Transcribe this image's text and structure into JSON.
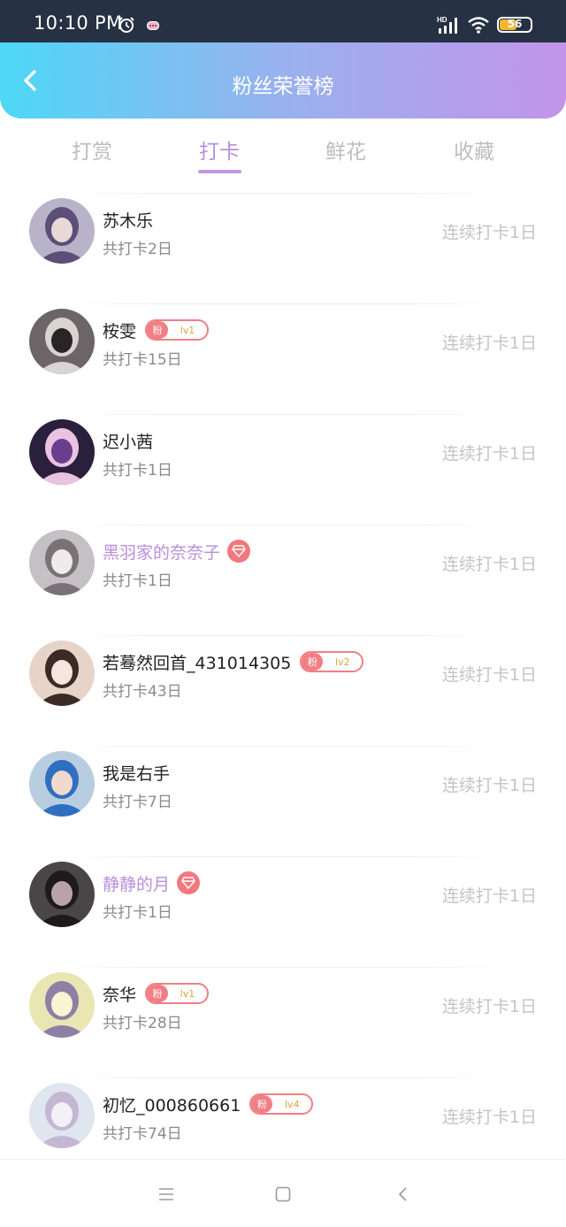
{
  "status_bar": {
    "time": "10:10 PM",
    "battery": "56",
    "battery_level": 0.56,
    "icons": [
      "alarm-icon",
      "message-icon",
      "hd-signal-icon",
      "wifi-icon",
      "battery-icon"
    ]
  },
  "header": {
    "title": "粉丝荣誉榜",
    "back_icon": "chevron-left-icon"
  },
  "tabs": [
    {
      "label": "打赏",
      "active": false
    },
    {
      "label": "打卡",
      "active": true
    },
    {
      "label": "鲜花",
      "active": false
    },
    {
      "label": "收藏",
      "active": false
    }
  ],
  "colors": {
    "header_gradient": [
      "#4dd8f6",
      "#c294ea"
    ],
    "accent": "#b98ede",
    "fan_badge": "#f07f85",
    "level_text": "#e2a142",
    "streak_text": "#c4c4c4"
  },
  "users": [
    {
      "name": "苏木乐",
      "vip": false,
      "fan_badge": null,
      "total": "共打卡2日",
      "streak": "连续打卡1日"
    },
    {
      "name": "桉雯",
      "vip": false,
      "fan_badge": {
        "label": "粉",
        "level": "lv1"
      },
      "total": "共打卡15日",
      "streak": "连续打卡1日"
    },
    {
      "name": "迟小茜",
      "vip": false,
      "fan_badge": null,
      "total": "共打卡1日",
      "streak": "连续打卡1日"
    },
    {
      "name": "黑羽家的奈奈子",
      "vip": true,
      "fan_badge": null,
      "total": "共打卡1日",
      "streak": "连续打卡1日"
    },
    {
      "name": "若蓦然回首_431014305",
      "vip": false,
      "fan_badge": {
        "label": "粉",
        "level": "lv2"
      },
      "total": "共打卡43日",
      "streak": "连续打卡1日"
    },
    {
      "name": "我是右手",
      "vip": false,
      "fan_badge": null,
      "total": "共打卡7日",
      "streak": "连续打卡1日"
    },
    {
      "name": "静静的月",
      "vip": true,
      "fan_badge": null,
      "total": "共打卡1日",
      "streak": "连续打卡1日"
    },
    {
      "name": "奈华",
      "vip": false,
      "fan_badge": {
        "label": "粉",
        "level": "lv1"
      },
      "total": "共打卡28日",
      "streak": "连续打卡1日"
    },
    {
      "name": "初忆_000860661",
      "vip": false,
      "fan_badge": {
        "label": "粉",
        "level": "lv4"
      },
      "total": "共打卡74日",
      "streak": "连续打卡1日"
    }
  ],
  "nav_bar": {
    "icons": [
      "menu-icon",
      "home-square-icon",
      "back-triangle-icon"
    ]
  }
}
